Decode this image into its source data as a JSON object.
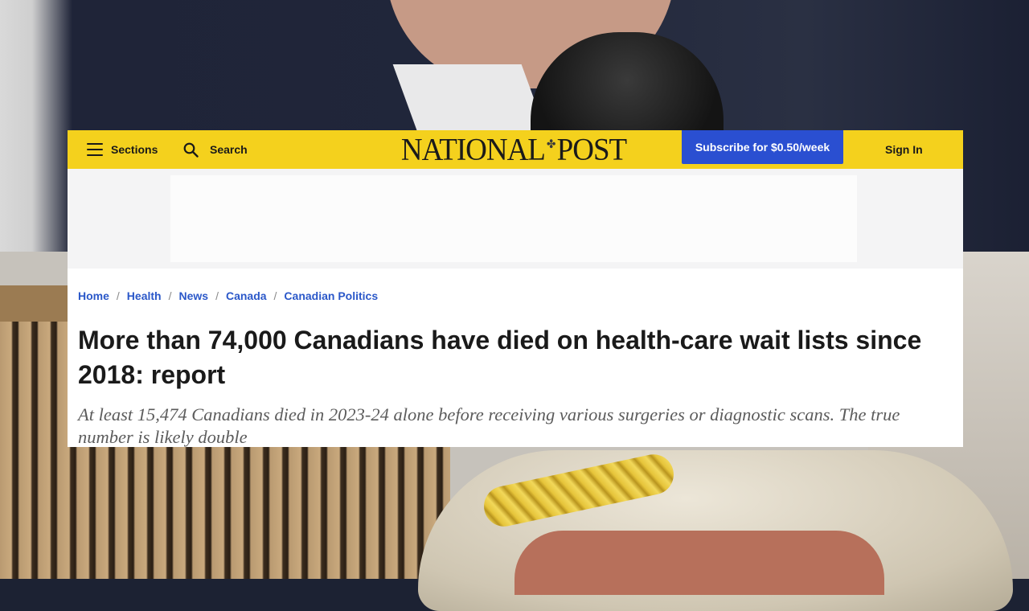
{
  "header": {
    "sections_label": "Sections",
    "search_label": "Search",
    "logo_text_left": "NATIONAL",
    "logo_text_right": "POST",
    "subscribe_label": "Subscribe for $0.50/week",
    "signin_label": "Sign In"
  },
  "breadcrumb": [
    "Home",
    "Health",
    "News",
    "Canada",
    "Canadian Politics"
  ],
  "article": {
    "headline": "More than 74,000 Canadians have died on health-care wait lists since 2018: report",
    "deck": "At least 15,474 Canadians died in 2023-24 alone before receiving various surgeries or diagnostic scans. The true number is likely double"
  },
  "colors": {
    "header_yellow": "#f4d11d",
    "subscribe_blue": "#2a4fd1",
    "link_blue": "#2b58c9"
  },
  "icons": [
    "menu-icon",
    "search-icon",
    "maple-leaf-icon"
  ]
}
